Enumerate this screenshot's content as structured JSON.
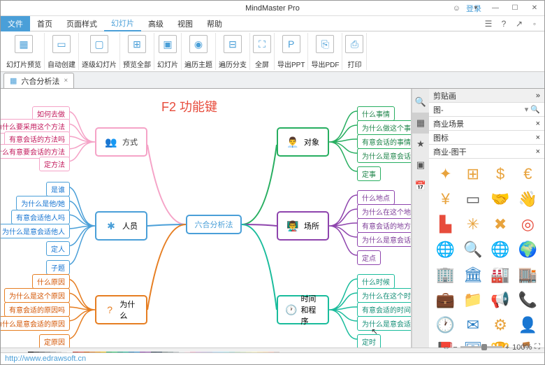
{
  "title": "MindMaster Pro",
  "login": {
    "icon": "☺",
    "text": "登录"
  },
  "winbtns": {
    "min": "—",
    "max": "☐",
    "close": "✕",
    "drop": "▾"
  },
  "menu": {
    "file": "文件",
    "tabs": [
      "首页",
      "页面样式",
      "幻灯片",
      "高级",
      "视图",
      "帮助"
    ],
    "right": [
      "☰",
      "?",
      "↗",
      "◦"
    ]
  },
  "ribbon": [
    {
      "icon": "▦",
      "label": "幻灯片预览"
    },
    {
      "icon": "▭",
      "label": "自动创建"
    },
    {
      "icon": "▢",
      "label": "逐级幻灯片"
    },
    {
      "icon": "⊞",
      "label": "预览全部"
    },
    {
      "icon": "▣",
      "label": "幻灯片"
    },
    {
      "icon": "◉",
      "label": "遍历主题"
    },
    {
      "icon": "⊟",
      "label": "遍历分支"
    },
    {
      "icon": "⛶",
      "label": "全屏"
    },
    {
      "icon": "P",
      "label": "导出PPT"
    },
    {
      "icon": "⎘",
      "label": "导出PDF"
    },
    {
      "icon": "⎙",
      "label": "打印"
    }
  ],
  "doctab": {
    "name": "六合分析法",
    "icon": "▦",
    "close": "×"
  },
  "annotation": "F2 功能键",
  "center": "六合分析法",
  "branches": {
    "way": {
      "label": "方式",
      "leaves": [
        "如何去做",
        "为什么要采用这个方法",
        "有意会话的方法吗",
        "为什么有意要会话的方法",
        "定方法"
      ]
    },
    "ppl": {
      "label": "人员",
      "leaves": [
        "是谁",
        "为什么是他/她",
        "有意会适他人吗",
        "为什么是意会适他人",
        "定人",
        "子题"
      ]
    },
    "why": {
      "label": "为什么",
      "leaves": [
        "什么原因",
        "为什么是这个原因",
        "有意会适的原因吗",
        "为什么是意会适的原因",
        "定原因"
      ]
    },
    "obj": {
      "label": "对象",
      "leaves": [
        "什么事情",
        "为什么做这个事情",
        "有意会话的事情吗",
        "为什么是意会话的事情",
        "定事"
      ]
    },
    "plc": {
      "label": "场所",
      "leaves": [
        "什么地点",
        "为什么在这个地点",
        "有意会话的地方吗",
        "为什么是意会话的地点",
        "定点"
      ]
    },
    "tim": {
      "label": "时间和程序",
      "leaves": [
        "什么时候",
        "为什么在这个时候",
        "有意会适的时间吗",
        "为什么是意会适的时间",
        "定时"
      ]
    }
  },
  "side": {
    "title": "剪贴画",
    "search": "图-",
    "groups": [
      "商业场景",
      "图标",
      "商业-图干"
    ],
    "x": "×",
    "arrow": "»"
  },
  "shapes": [
    {
      "c": "#e8a33d",
      "t": "✦"
    },
    {
      "c": "#e8a33d",
      "t": "⊞"
    },
    {
      "c": "#e8a33d",
      "t": "$"
    },
    {
      "c": "#e8a33d",
      "t": "€"
    },
    {
      "c": "#e8a33d",
      "t": "¥"
    },
    {
      "c": "#555",
      "t": "▭"
    },
    {
      "c": "#e8a33d",
      "t": "🤝"
    },
    {
      "c": "#e8a33d",
      "t": "👋"
    },
    {
      "c": "#e74c3c",
      "t": "▙"
    },
    {
      "c": "#e8a33d",
      "t": "✳"
    },
    {
      "c": "#e8a33d",
      "t": "✖"
    },
    {
      "c": "#e74c3c",
      "t": "◎"
    },
    {
      "c": "#1a9e8f",
      "t": "🌐"
    },
    {
      "c": "#1a9e8f",
      "t": "🔍"
    },
    {
      "c": "#2b7fc4",
      "t": "🌐"
    },
    {
      "c": "#2b7fc4",
      "t": "🌍"
    },
    {
      "c": "#2b7fc4",
      "t": "🏢"
    },
    {
      "c": "#2b7fc4",
      "t": "🏛"
    },
    {
      "c": "#2b7fc4",
      "t": "🏭"
    },
    {
      "c": "#2b7fc4",
      "t": "🏬"
    },
    {
      "c": "#2b7fc4",
      "t": "💼"
    },
    {
      "c": "#2b7fc4",
      "t": "📁"
    },
    {
      "c": "#e8a33d",
      "t": "📢"
    },
    {
      "c": "#e8a33d",
      "t": "📞"
    },
    {
      "c": "#e8a33d",
      "t": "🕐"
    },
    {
      "c": "#2b7fc4",
      "t": "✉"
    },
    {
      "c": "#e8a33d",
      "t": "⚙"
    },
    {
      "c": "#1a9e8f",
      "t": "👤"
    },
    {
      "c": "#e8a33d",
      "t": "📕"
    },
    {
      "c": "#2b7fc4",
      "t": "🗄"
    },
    {
      "c": "#e8a33d",
      "t": "🏆"
    },
    {
      "c": "#8e9499",
      "t": "🪑"
    }
  ],
  "zoom": {
    "minus": "−",
    "plus": "+",
    "val": "100%",
    "fit": "⛶",
    "arrows": "⇔"
  },
  "footer": "http://www.edrawsoft.cn",
  "palette": [
    "#000",
    "#444",
    "#666",
    "#888",
    "#aaa",
    "#ccc",
    "#eee",
    "#fff",
    "#c0392b",
    "#e74c3c",
    "#d35400",
    "#e67e22",
    "#f39c12",
    "#f1c40f",
    "#27ae60",
    "#2ecc71",
    "#16a085",
    "#1abc9c",
    "#2980b9",
    "#3498db",
    "#8e44ad",
    "#9b59b6",
    "#2c3e50",
    "#34495e",
    "#7f8c8d",
    "#95a5a6",
    "#bdc3c7",
    "#ecf0f1",
    "#fce4ec",
    "#f8bbd0",
    "#e1bee7",
    "#d1c4e9",
    "#c5cae9",
    "#bbdefb",
    "#b3e5fc",
    "#b2ebf2",
    "#b2dfdb",
    "#c8e6c9",
    "#dcedc8",
    "#f0f4c3",
    "#fff9c4",
    "#ffecb3",
    "#ffe0b2",
    "#ffccbc",
    "#d7ccc8"
  ]
}
